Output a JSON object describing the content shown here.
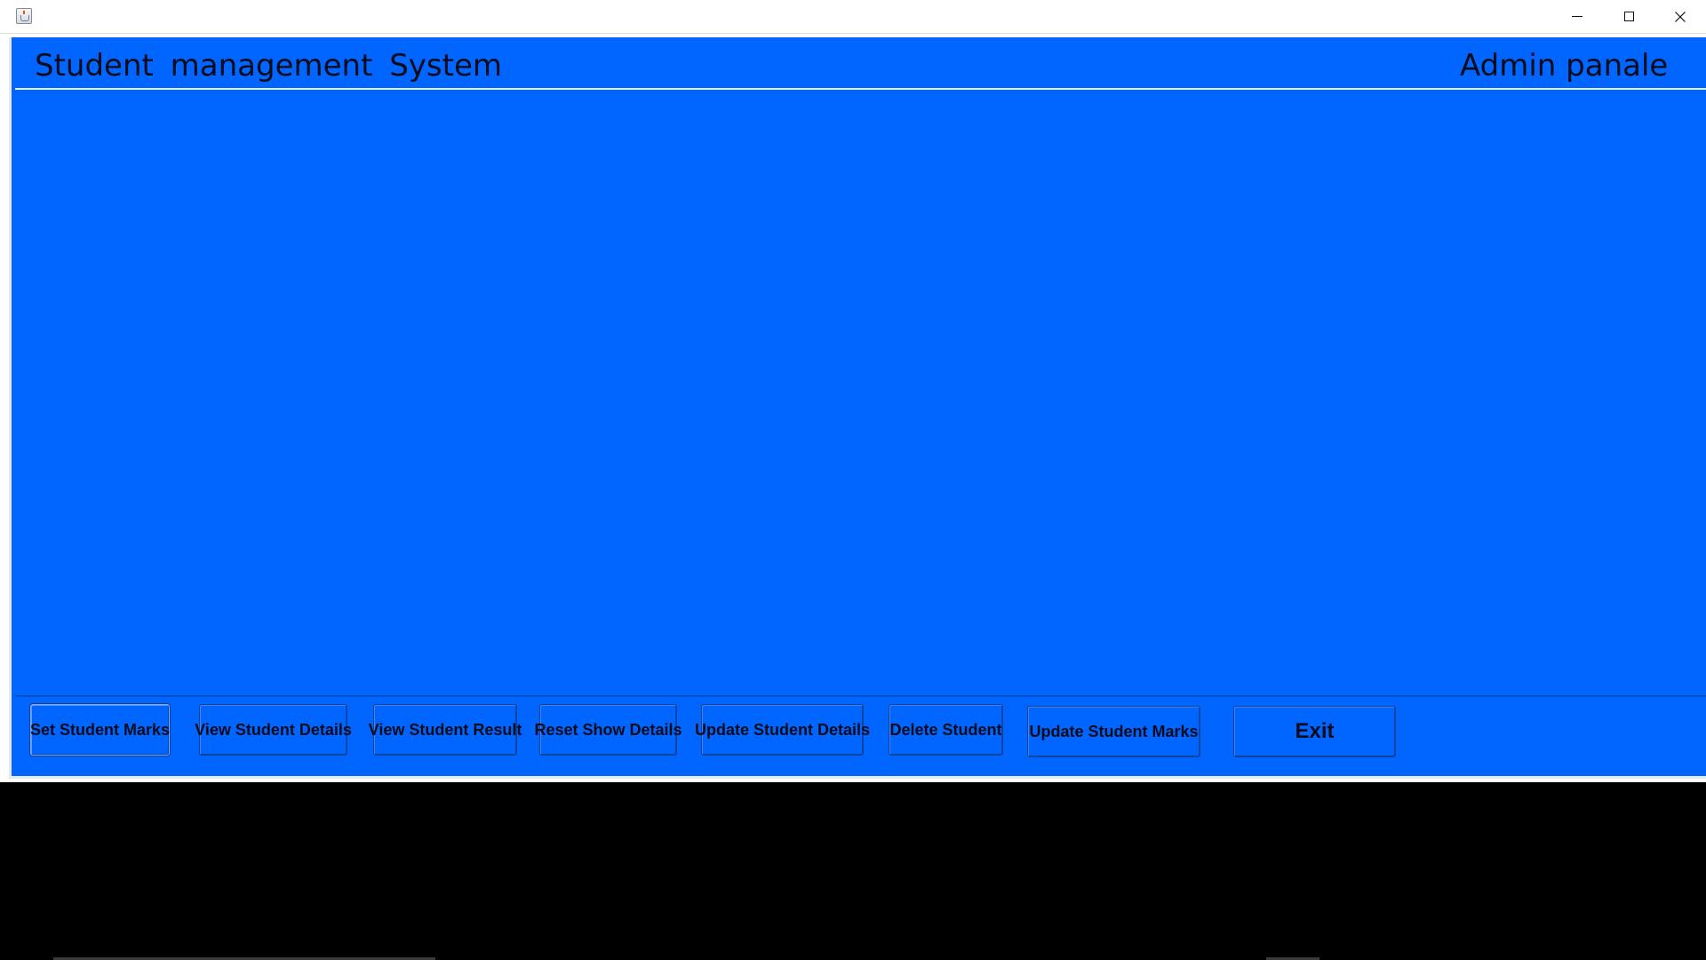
{
  "window": {
    "title": "",
    "controls": {
      "minimize": "minimize-icon",
      "maximize": "maximize-icon",
      "close": "close-icon"
    }
  },
  "header": {
    "title": "Student  management  System",
    "panel_label": "Admin panale"
  },
  "buttons": {
    "set_marks": "Set Student Marks",
    "view_details": "View Student Details",
    "view_result": "View Student Result",
    "reset_details": "Reset Show Details",
    "update_details": "Update Student Details",
    "delete_student": "Delete Student",
    "update_marks": "Update Student Marks",
    "exit": "Exit"
  },
  "colors": {
    "panel_background": "#0066ff",
    "desktop_background": "#000000",
    "text": "#0b0b1a"
  }
}
